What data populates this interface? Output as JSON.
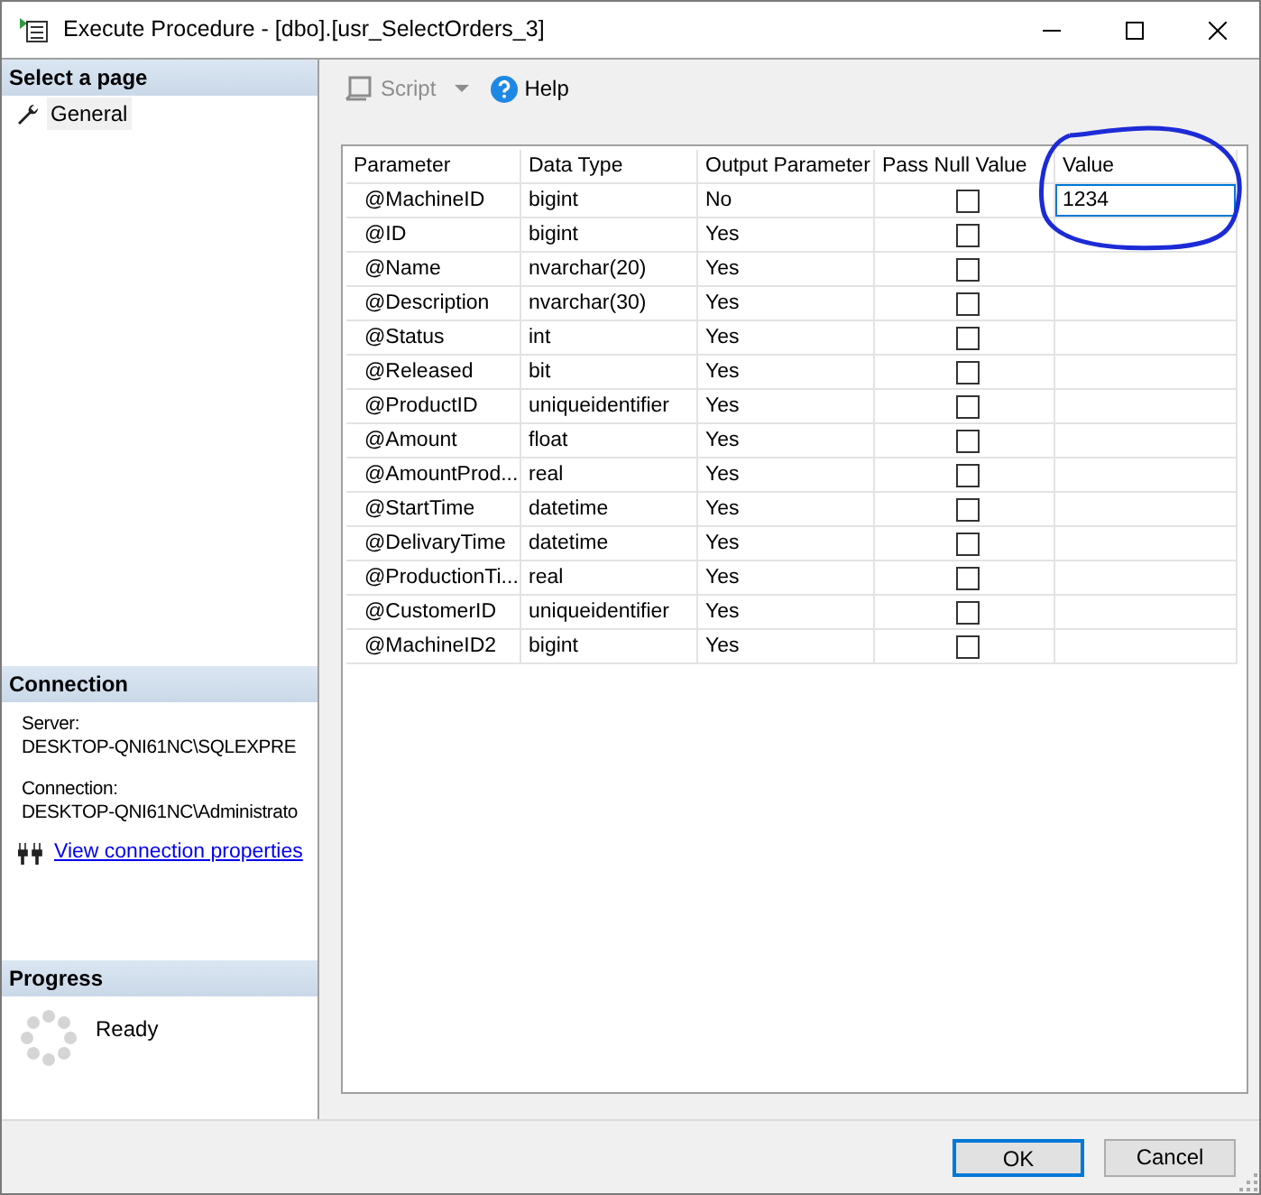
{
  "window": {
    "title": "Execute Procedure - [dbo].[usr_SelectOrders_3]"
  },
  "sidebar": {
    "pages_header": "Select a page",
    "pages": [
      {
        "label": "General",
        "selected": true
      }
    ],
    "connection_header": "Connection",
    "server_label": "Server:",
    "server": "DESKTOP-QNI61NC\\SQLEXPRE",
    "connection_label": "Connection:",
    "connection": "DESKTOP-QNI61NC\\Administrato",
    "link": "View connection properties",
    "progress_header": "Progress",
    "progress_status": "Ready"
  },
  "toolbar": {
    "script": {
      "label": "Script",
      "disabled": true
    },
    "help": {
      "label": "Help"
    }
  },
  "grid": {
    "columns": [
      "Parameter",
      "Data Type",
      "Output Parameter",
      "Pass Null Value",
      "Value"
    ],
    "rows": [
      {
        "parameter": "@MachineID",
        "data_type": "bigint",
        "output": "No",
        "pass_null": false,
        "value": "1234"
      },
      {
        "parameter": "@ID",
        "data_type": "bigint",
        "output": "Yes",
        "pass_null": false
      },
      {
        "parameter": "@Name",
        "data_type": "nvarchar(20)",
        "output": "Yes",
        "pass_null": false
      },
      {
        "parameter": "@Description",
        "data_type": "nvarchar(30)",
        "output": "Yes",
        "pass_null": false
      },
      {
        "parameter": "@Status",
        "data_type": "int",
        "output": "Yes",
        "pass_null": false
      },
      {
        "parameter": "@Released",
        "data_type": "bit",
        "output": "Yes",
        "pass_null": false
      },
      {
        "parameter": "@ProductID",
        "data_type": "uniqueidentifier",
        "output": "Yes",
        "pass_null": false
      },
      {
        "parameter": "@Amount",
        "data_type": "float",
        "output": "Yes",
        "pass_null": false
      },
      {
        "parameter": "@AmountProd...",
        "data_type": "real",
        "output": "Yes",
        "pass_null": false
      },
      {
        "parameter": "@StartTime",
        "data_type": "datetime",
        "output": "Yes",
        "pass_null": false
      },
      {
        "parameter": "@DelivaryTime",
        "data_type": "datetime",
        "output": "Yes",
        "pass_null": false
      },
      {
        "parameter": "@ProductionTi...",
        "data_type": "real",
        "output": "Yes",
        "pass_null": false
      },
      {
        "parameter": "@CustomerID",
        "data_type": "uniqueidentifier",
        "output": "Yes",
        "pass_null": false
      },
      {
        "parameter": "@MachineID2",
        "data_type": "bigint",
        "output": "Yes",
        "pass_null": false
      }
    ]
  },
  "buttons": [
    {
      "label": "OK",
      "default": true
    },
    {
      "label": "Cancel",
      "default": false
    }
  ]
}
